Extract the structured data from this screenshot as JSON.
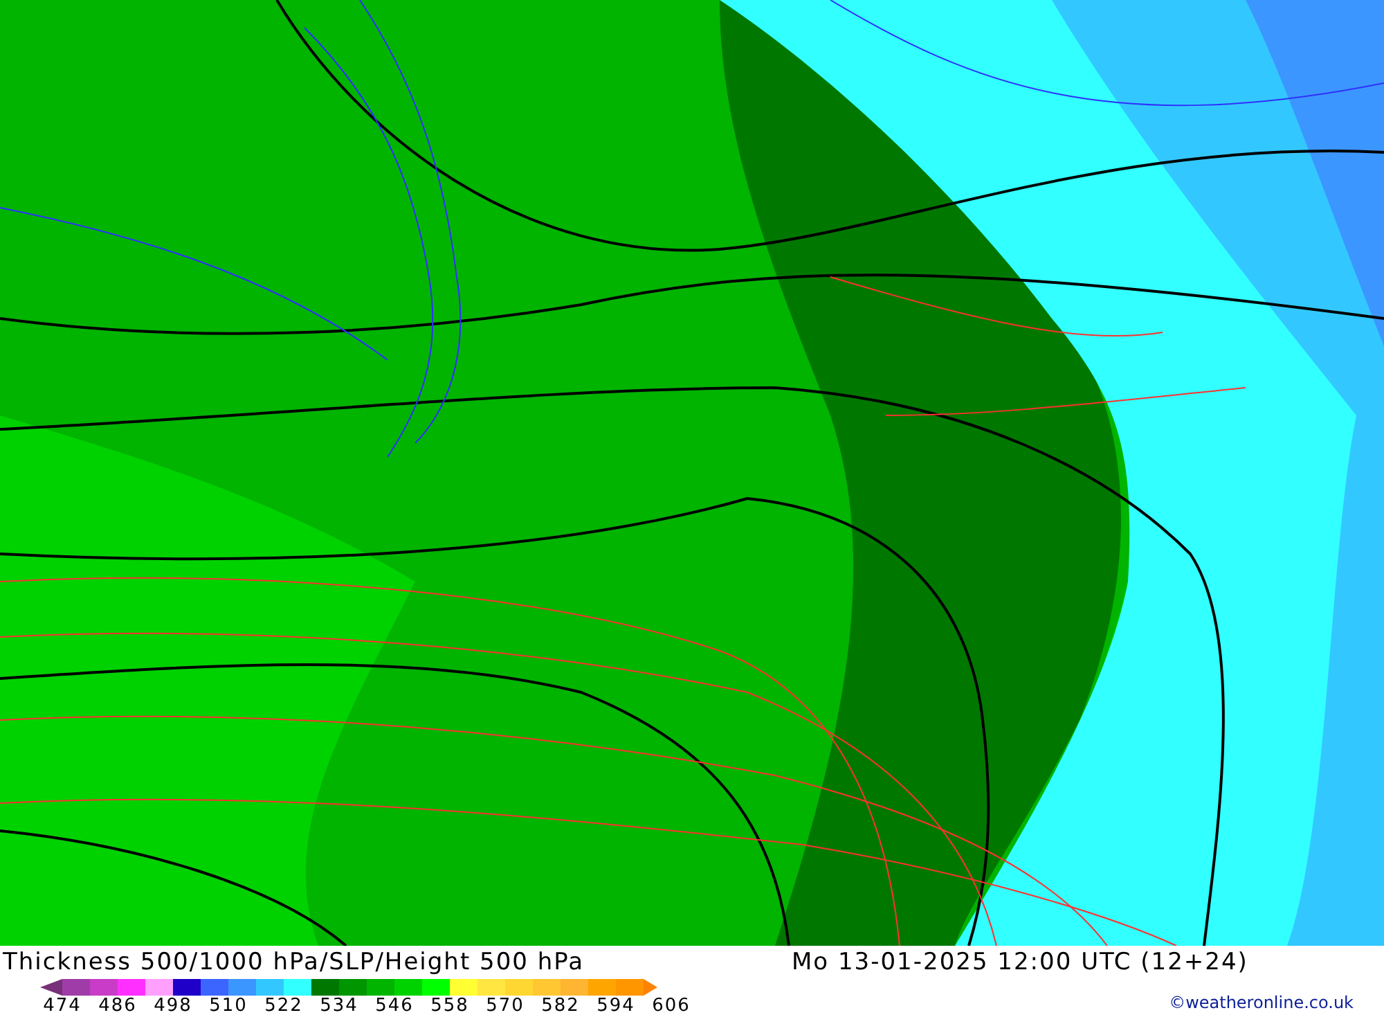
{
  "title": "Thickness 500/1000 hPa/SLP/Height 500 hPa",
  "valid_time": "Mo 13-01-2025 12:00 UTC (12+24)",
  "legend": {
    "segments": [
      {
        "color": "#a03ca8"
      },
      {
        "color": "#c83cc8"
      },
      {
        "color": "#ff30ff"
      },
      {
        "color": "#ffa0ff"
      },
      {
        "color": "#1e00c8"
      },
      {
        "color": "#3c64ff"
      },
      {
        "color": "#3c96ff"
      },
      {
        "color": "#32c8ff"
      },
      {
        "color": "#32ffff"
      },
      {
        "color": "#007800"
      },
      {
        "color": "#009600"
      },
      {
        "color": "#00b400"
      },
      {
        "color": "#00d200"
      },
      {
        "color": "#00ff00"
      },
      {
        "color": "#ffff32"
      },
      {
        "color": "#ffe640"
      },
      {
        "color": "#ffd732"
      },
      {
        "color": "#ffc832"
      },
      {
        "color": "#ffb432"
      },
      {
        "color": "#ffa500"
      },
      {
        "color": "#ff9600"
      }
    ],
    "ticks": [
      "474",
      "486",
      "498",
      "510",
      "522",
      "534",
      "546",
      "558",
      "570",
      "582",
      "594",
      "606"
    ]
  },
  "copyright": "©weatheronline.co.uk"
}
